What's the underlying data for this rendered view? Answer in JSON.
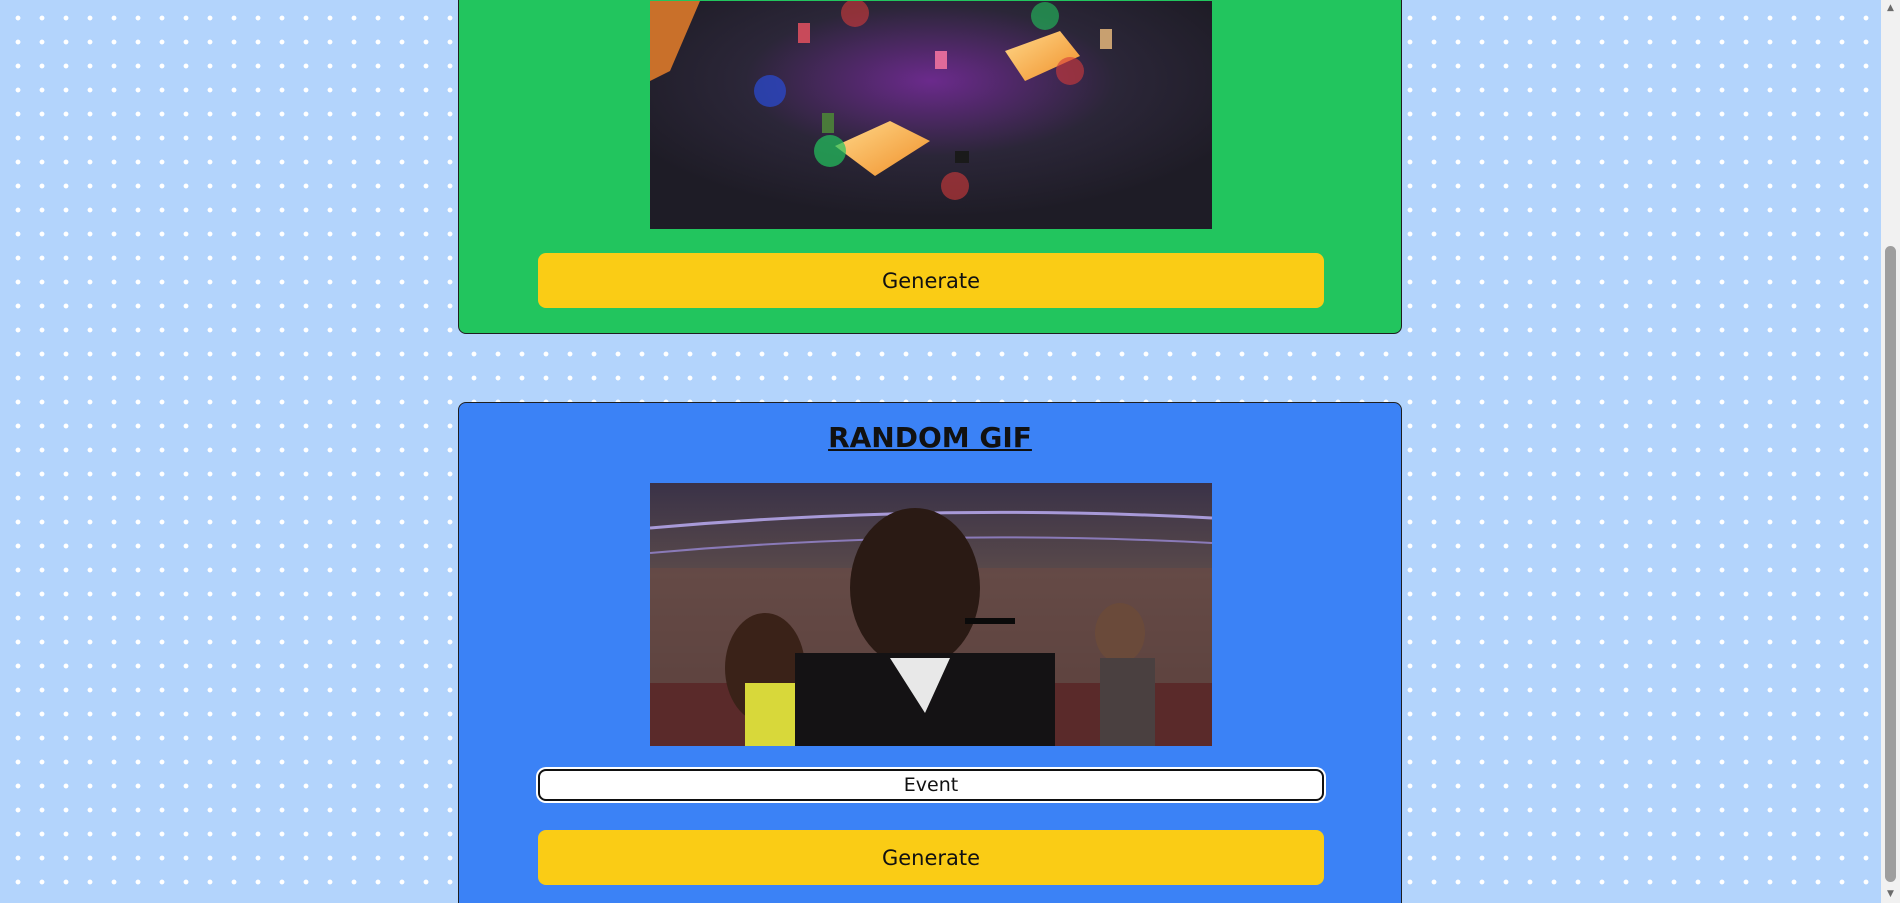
{
  "cards": [
    {
      "id": "upper",
      "gif_alt": "game arena animation",
      "button_label": "Generate",
      "color": "#22c55e"
    },
    {
      "id": "random",
      "title": "RANDOM GIF",
      "gif_alt": "audience applause animation",
      "search_value": "Event",
      "button_label": "Generate",
      "color": "#3b82f6"
    }
  ],
  "colors": {
    "page_background": "#b3d4fc",
    "button": "#facc15"
  },
  "scrollbar": {
    "up_icon": "chevron-up-icon",
    "down_icon": "chevron-down-icon"
  }
}
